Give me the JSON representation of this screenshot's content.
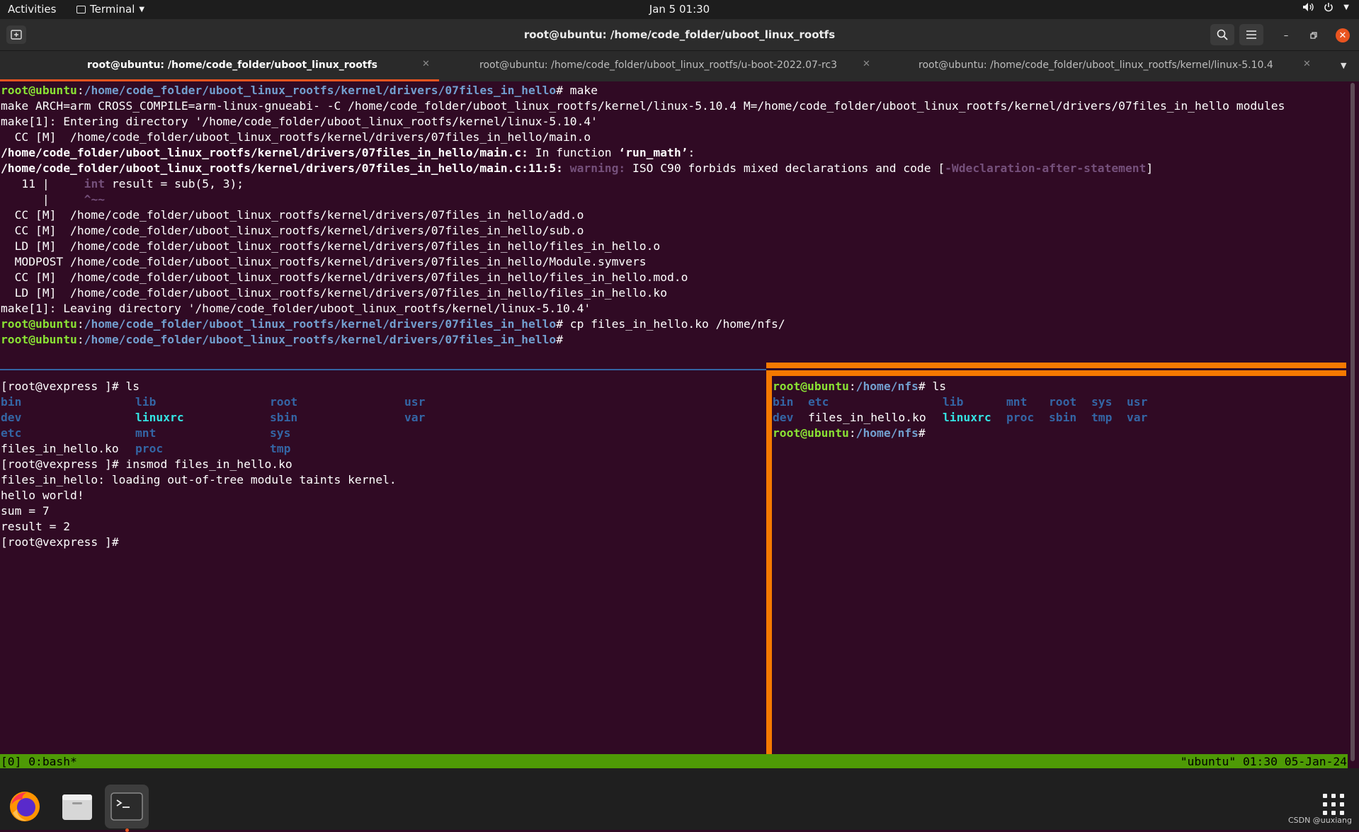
{
  "topbar": {
    "activities": "Activities",
    "app_menu": "Terminal",
    "clock": "Jan 5  01:30",
    "tray_icons": [
      "volume-icon",
      "power-icon",
      "chevron-down-icon"
    ]
  },
  "window": {
    "title": "root@ubuntu: /home/code_folder/uboot_linux_rootfs"
  },
  "tabs": [
    {
      "label": "root@ubuntu: /home/code_folder/uboot_linux_rootfs",
      "active": true
    },
    {
      "label": "root@ubuntu: /home/code_folder/uboot_linux_rootfs/u-boot-2022.07-rc3",
      "active": false
    },
    {
      "label": "root@ubuntu: /home/code_folder/uboot_linux_rootfs/kernel/linux-5.10.4",
      "active": false
    }
  ],
  "terminal_top": {
    "prompt_user": "root@ubuntu",
    "prompt_path": "/home/code_folder/uboot_linux_rootfs/kernel/drivers/07files_in_hello",
    "cmd1": "# make",
    "lines": [
      "make ARCH=arm CROSS_COMPILE=arm-linux-gnueabi- -C /home/code_folder/uboot_linux_rootfs/kernel/linux-5.10.4 M=/home/code_folder/uboot_linux_rootfs/kernel/drivers/07files_in_hello modules",
      "make[1]: Entering directory '/home/code_folder/uboot_linux_rootfs/kernel/linux-5.10.4'",
      "  CC [M]  /home/code_folder/uboot_linux_rootfs/kernel/drivers/07files_in_hello/main.o"
    ],
    "fn_file": "/home/code_folder/uboot_linux_rootfs/kernel/drivers/07files_in_hello/main.c:",
    "fn_text": " In function ",
    "fn_name": "‘run_math’",
    "fn_end": ":",
    "warn_file": "/home/code_folder/uboot_linux_rootfs/kernel/drivers/07files_in_hello/main.c:11:5:",
    "warn_label": " warning:",
    "warn_text": " ISO C90 forbids mixed declarations and code [",
    "warn_flag": "-Wdeclaration-after-statement",
    "warn_end": "]",
    "src_lineno": "   11 |     ",
    "src_int": "int",
    "src_rest": " result = sub(5, 3);",
    "caret_prefix": "      |     ",
    "caret": "^~~",
    "lines2": [
      "  CC [M]  /home/code_folder/uboot_linux_rootfs/kernel/drivers/07files_in_hello/add.o",
      "  CC [M]  /home/code_folder/uboot_linux_rootfs/kernel/drivers/07files_in_hello/sub.o",
      "  LD [M]  /home/code_folder/uboot_linux_rootfs/kernel/drivers/07files_in_hello/files_in_hello.o",
      "  MODPOST /home/code_folder/uboot_linux_rootfs/kernel/drivers/07files_in_hello/Module.symvers",
      "  CC [M]  /home/code_folder/uboot_linux_rootfs/kernel/drivers/07files_in_hello/files_in_hello.mod.o",
      "  LD [M]  /home/code_folder/uboot_linux_rootfs/kernel/drivers/07files_in_hello/files_in_hello.ko",
      "make[1]: Leaving directory '/home/code_folder/uboot_linux_rootfs/kernel/linux-5.10.4'"
    ],
    "cmd2": "# cp files_in_hello.ko /home/nfs/",
    "cmd3": "#"
  },
  "pane_left": {
    "prompt": "[root@vexpress ]# ls",
    "ls": [
      [
        "bin",
        "lib",
        "root",
        "usr"
      ],
      [
        "dev",
        "linuxrc",
        "sbin",
        "var"
      ],
      [
        "etc",
        "mnt",
        "sys",
        ""
      ],
      [
        "files_in_hello.ko",
        "proc",
        "tmp",
        ""
      ]
    ],
    "lines": [
      "[root@vexpress ]# insmod files_in_hello.ko",
      "files_in_hello: loading out-of-tree module taints kernel.",
      "hello world!",
      "sum = 7",
      "result = 2",
      "[root@vexpress ]#"
    ]
  },
  "pane_right": {
    "prompt_user": "root@ubuntu",
    "prompt_path": "/home/nfs",
    "cmd": "# ls",
    "ls": [
      [
        "bin",
        "etc",
        "lib",
        "mnt",
        "root",
        "sys",
        "usr"
      ],
      [
        "dev",
        "files_in_hello.ko",
        "linuxrc",
        "proc",
        "sbin",
        "tmp",
        "var"
      ]
    ],
    "end": "#"
  },
  "tmux": {
    "left": "[0] 0:bash*",
    "right": "\"ubuntu\" 01:30 05-Jan-24"
  },
  "dock": {
    "apps": [
      "firefox-icon",
      "files-icon",
      "terminal-icon"
    ],
    "grid": "show-applications-icon"
  },
  "watermark": "CSDN @uuxiang",
  "colors": {
    "terminal_bg": "#300a24",
    "prompt_green": "#8ae234",
    "path_blue": "#729fcf",
    "tmux_green": "#4e9a06",
    "pane_border_active": "#f57900",
    "tab_underline": "#e95420"
  }
}
